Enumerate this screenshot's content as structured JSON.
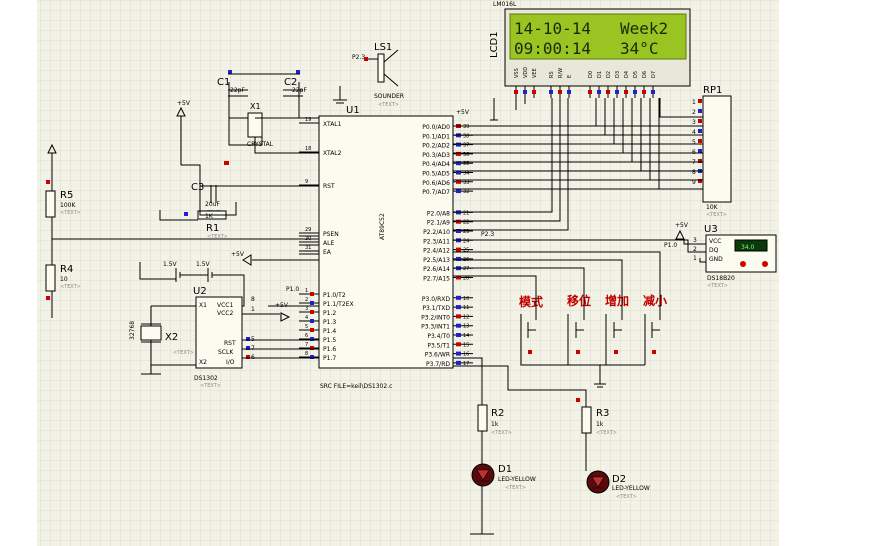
{
  "lcd": {
    "label": "LCD1",
    "model": "LM016L",
    "line1_left": "14-10-14",
    "line1_right": "Week2",
    "line2_left": "09:00:14",
    "line2_right": "34°C",
    "pins": [
      "VSS",
      "VDD",
      "VEE",
      "RS",
      "R/W",
      "E",
      "D0",
      "D1",
      "D2",
      "D3",
      "D4",
      "D5",
      "D6",
      "D7"
    ]
  },
  "mcu": {
    "label": "U1",
    "part": "AT89C52",
    "src": "SRC FILE=keil\\DS1302.c",
    "left_pins": [
      {
        "name": "XTAL1",
        "num": "19"
      },
      {
        "name": "XTAL2",
        "num": "18"
      },
      {
        "name": "RST",
        "num": "9"
      },
      {
        "name": "PSEN",
        "num": "29"
      },
      {
        "name": "ALE",
        "num": "30"
      },
      {
        "name": "EA",
        "num": "31"
      },
      {
        "name": "P1.0/T2",
        "num": "1"
      },
      {
        "name": "P1.1/T2EX",
        "num": "2"
      },
      {
        "name": "P1.2",
        "num": "3"
      },
      {
        "name": "P1.3",
        "num": "4"
      },
      {
        "name": "P1.4",
        "num": "5"
      },
      {
        "name": "P1.5",
        "num": "6"
      },
      {
        "name": "P1.6",
        "num": "7"
      },
      {
        "name": "P1.7",
        "num": "8"
      }
    ],
    "right_pins": [
      {
        "name": "P0.0/AD0",
        "num": "39"
      },
      {
        "name": "P0.1/AD1",
        "num": "38"
      },
      {
        "name": "P0.2/AD2",
        "num": "37"
      },
      {
        "name": "P0.3/AD3",
        "num": "36"
      },
      {
        "name": "P0.4/AD4",
        "num": "35"
      },
      {
        "name": "P0.5/AD5",
        "num": "34"
      },
      {
        "name": "P0.6/AD6",
        "num": "33"
      },
      {
        "name": "P0.7/AD7",
        "num": "32"
      },
      {
        "name": "P2.0/A8",
        "num": "21"
      },
      {
        "name": "P2.1/A9",
        "num": "22"
      },
      {
        "name": "P2.2/A10",
        "num": "23"
      },
      {
        "name": "P2.3/A11",
        "num": "24"
      },
      {
        "name": "P2.4/A12",
        "num": "25"
      },
      {
        "name": "P2.5/A13",
        "num": "26"
      },
      {
        "name": "P2.6/A14",
        "num": "27"
      },
      {
        "name": "P2.7/A15",
        "num": "28"
      },
      {
        "name": "P3.0/RXD",
        "num": "10"
      },
      {
        "name": "P3.1/TXD",
        "num": "11"
      },
      {
        "name": "P3.2/INT0",
        "num": "12"
      },
      {
        "name": "P3.3/INT1",
        "num": "13"
      },
      {
        "name": "P3.4/T0",
        "num": "14"
      },
      {
        "name": "P3.5/T1",
        "num": "15"
      },
      {
        "name": "P3.6/WR",
        "num": "16"
      },
      {
        "name": "P3.7/RD",
        "num": "17"
      }
    ]
  },
  "rp1": {
    "label": "RP1",
    "value": "10K",
    "pins": [
      "1",
      "2",
      "3",
      "4",
      "5",
      "6",
      "7",
      "8",
      "9"
    ]
  },
  "u3": {
    "label": "U3",
    "part": "DS18B20",
    "pins": [
      {
        "name": "VCC",
        "num": "3"
      },
      {
        "name": "DQ",
        "num": "2"
      },
      {
        "name": "GND",
        "num": "1"
      }
    ],
    "display": "34.0",
    "net": "P1.0"
  },
  "u2": {
    "label": "U2",
    "part": "DS1302",
    "pins": [
      {
        "name": "X1",
        "num": "2"
      },
      {
        "name": "X2",
        "num": "3"
      },
      {
        "name": "VCC1",
        "num": "8"
      },
      {
        "name": "VCC2",
        "num": "1"
      },
      {
        "name": "RST",
        "num": "5"
      },
      {
        "name": "SCLK",
        "num": "7"
      },
      {
        "name": "I/O",
        "num": "6"
      }
    ]
  },
  "x1": {
    "label": "X1",
    "value": "CRYSTAL"
  },
  "x2": {
    "label": "X2",
    "value": "32768"
  },
  "c1": {
    "label": "C1",
    "value": "22pF"
  },
  "c2": {
    "label": "C2",
    "value": "22pF"
  },
  "c3": {
    "label": "C3",
    "value": "20uF"
  },
  "r1": {
    "label": "R1",
    "value": "1K"
  },
  "r2": {
    "label": "R2",
    "value": "1k"
  },
  "r3": {
    "label": "R3",
    "value": "1k"
  },
  "r4": {
    "label": "R4",
    "value": "10"
  },
  "r5": {
    "label": "R5",
    "value": "100K"
  },
  "d1": {
    "label": "D1",
    "value": "LED-YELLOW"
  },
  "d2": {
    "label": "D2",
    "value": "LED-YELLOW"
  },
  "ls1": {
    "label": "LS1",
    "value": "SOUNDER",
    "net": "P2.3"
  },
  "net_p10": "P1.0",
  "net_p23": "P2.3",
  "power": {
    "plus5v": "+5V",
    "v15": "1.5V"
  },
  "placeholder_text": "<TEXT>",
  "buttons": [
    "模式",
    "移位",
    "增加",
    "减小"
  ]
}
